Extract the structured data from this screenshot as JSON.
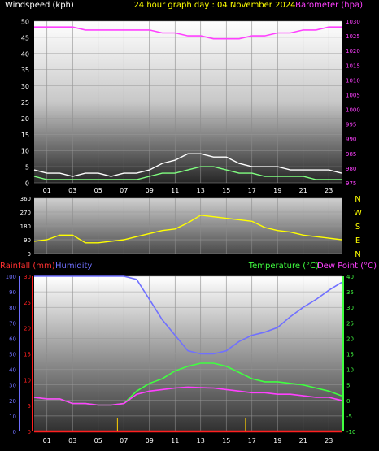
{
  "header": {
    "left_label": "Windspeed (kph)",
    "center_label": "24 hour graph day : 04 November 2024",
    "right_label": "Barometer (hpa)"
  },
  "colors": {
    "wind_avg": "#ffffff",
    "wind_gust": "#80ff80",
    "barometer": "#ff40ff",
    "direction": "#ffff00",
    "rainfall": "#ff2020",
    "humidity": "#7070ff",
    "temperature": "#40ff40",
    "dewpoint": "#ff40ff"
  },
  "bottom_labels": {
    "rainfall": "Rainfall (mm)",
    "humidity": "Humidity",
    "temperature": "Temperature (°C)",
    "dewpoint": "Dew Point (°C)"
  },
  "chart_data": [
    {
      "type": "line",
      "title": "24 hour graph day : 04 November 2024",
      "ylabel": "Windspeed (kph)",
      "y2label": "Barometer (hpa)",
      "ylim": [
        0,
        50
      ],
      "y2lim": [
        975,
        1030
      ],
      "yticks": [
        "0",
        "5",
        "10",
        "15",
        "20",
        "25",
        "30",
        "35",
        "40",
        "45",
        "50"
      ],
      "y2ticks": [
        "975",
        "980",
        "985",
        "990",
        "995",
        "1000",
        "1005",
        "1010",
        "1015",
        "1020",
        "1025",
        "1030"
      ],
      "x_ticks": [
        "01",
        "03",
        "05",
        "07",
        "09",
        "11",
        "13",
        "15",
        "17",
        "19",
        "21",
        "23"
      ],
      "x_hours": [
        0,
        1,
        2,
        3,
        4,
        5,
        6,
        7,
        8,
        9,
        10,
        11,
        12,
        13,
        14,
        15,
        16,
        17,
        18,
        19,
        20,
        21,
        22,
        23,
        24
      ],
      "series": [
        {
          "name": "Windspeed (kph)",
          "axis": "left",
          "values": [
            4,
            3,
            3,
            2,
            3,
            3,
            2,
            3,
            3,
            4,
            6,
            7,
            9,
            9,
            8,
            8,
            6,
            5,
            5,
            5,
            4,
            4,
            4,
            4,
            3
          ]
        },
        {
          "name": "Barometer (hpa)",
          "axis": "right",
          "values": [
            1028,
            1028,
            1028,
            1028,
            1027,
            1027,
            1027,
            1027,
            1027,
            1027,
            1026,
            1026,
            1025,
            1025,
            1024,
            1024,
            1024,
            1025,
            1025,
            1026,
            1026,
            1027,
            1027,
            1028,
            1028
          ]
        }
      ],
      "gust_values": [
        2,
        1,
        1,
        1,
        1,
        1,
        1,
        1,
        1,
        2,
        3,
        3,
        4,
        5,
        5,
        4,
        3,
        3,
        2,
        2,
        2,
        2,
        1,
        1,
        1
      ]
    },
    {
      "type": "line",
      "ylabel": "Wind direction",
      "ylim": [
        0,
        360
      ],
      "yticks": [
        "0",
        "90",
        "180",
        "270",
        "360"
      ],
      "compass": [
        "N",
        "W",
        "S",
        "E",
        "N"
      ],
      "x_hours": [
        0,
        1,
        2,
        3,
        4,
        5,
        6,
        7,
        8,
        9,
        10,
        11,
        12,
        13,
        14,
        15,
        16,
        17,
        18,
        19,
        20,
        21,
        22,
        23,
        24
      ],
      "series": [
        {
          "name": "Wind direction",
          "values": [
            80,
            90,
            120,
            120,
            70,
            70,
            80,
            90,
            110,
            130,
            150,
            160,
            200,
            250,
            240,
            230,
            220,
            210,
            170,
            150,
            140,
            120,
            110,
            100,
            90
          ]
        }
      ]
    },
    {
      "type": "line",
      "yticks_rain": [
        "0",
        "5",
        "10",
        "15",
        "20",
        "25",
        "30"
      ],
      "yticks_hum": [
        "0",
        "10",
        "20",
        "30",
        "40",
        "50",
        "60",
        "70",
        "80",
        "90",
        "100"
      ],
      "yticks_temp": [
        "-10",
        "-5",
        "0",
        "5",
        "10",
        "15",
        "20",
        "25",
        "30",
        "35",
        "40"
      ],
      "ylim_rain": [
        0,
        30
      ],
      "ylim_hum": [
        0,
        100
      ],
      "ylim_temp": [
        -10,
        40
      ],
      "x_ticks": [
        "01",
        "03",
        "05",
        "07",
        "09",
        "11",
        "13",
        "15",
        "17",
        "19",
        "21",
        "23"
      ],
      "x_hours": [
        0,
        1,
        2,
        3,
        4,
        5,
        6,
        7,
        8,
        9,
        10,
        11,
        12,
        13,
        14,
        15,
        16,
        17,
        18,
        19,
        20,
        21,
        22,
        23,
        24
      ],
      "series": [
        {
          "name": "Rainfall (mm)",
          "axis": "rain",
          "values": [
            0,
            0,
            0,
            0,
            0,
            0,
            0,
            0,
            0,
            0,
            0,
            0,
            0,
            0,
            0,
            0,
            0,
            0,
            0,
            0,
            0,
            0,
            0,
            0,
            0
          ]
        },
        {
          "name": "Humidity",
          "axis": "humidity",
          "values": [
            100,
            100,
            100,
            100,
            100,
            100,
            100,
            100,
            98,
            85,
            72,
            62,
            52,
            50,
            50,
            52,
            58,
            62,
            64,
            67,
            74,
            80,
            85,
            91,
            96
          ]
        },
        {
          "name": "Temperature (°C)",
          "axis": "temp",
          "values": [
            1,
            0.5,
            0.5,
            -1,
            -1,
            -1.5,
            -1.5,
            -1,
            3,
            5.5,
            7,
            9.5,
            11,
            12,
            12,
            11,
            9,
            7,
            6,
            6,
            5.5,
            5,
            4,
            3,
            1.5
          ]
        },
        {
          "name": "Dew Point (°C)",
          "axis": "temp",
          "values": [
            1,
            0.5,
            0.5,
            -1,
            -1,
            -1.5,
            -1.5,
            -1,
            2,
            3,
            3.5,
            4,
            4.3,
            4.1,
            4,
            3.5,
            3,
            2.5,
            2.5,
            2,
            2,
            1.5,
            1,
            1,
            0
          ]
        }
      ],
      "rain_markers": [
        6.5,
        16.5
      ]
    }
  ]
}
